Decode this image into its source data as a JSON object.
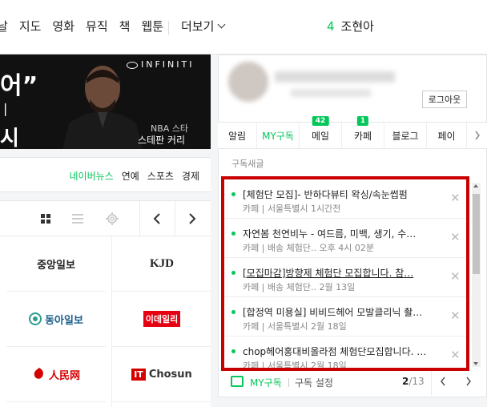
{
  "nav": {
    "items": [
      "날",
      "지도",
      "영화",
      "뮤직",
      "책",
      "웹툰"
    ],
    "more_label": "더보기",
    "weather": {
      "temp": "4",
      "location": "조현아"
    }
  },
  "banner": {
    "quote": "어”",
    "line1": "|",
    "line2": "시",
    "brand": "INFINITI",
    "caption1": "NBA 스타",
    "caption2": "스테판 커리"
  },
  "news_tabs": [
    "네이버뉴스",
    "연예",
    "스포츠",
    "경제"
  ],
  "press": [
    "중앙일보",
    "KJD",
    "동아일보",
    "이데일리",
    "人民网",
    "Chosun"
  ],
  "account": {
    "logout_label": "로그아웃"
  },
  "tabs": [
    {
      "label": "알림",
      "badge": ""
    },
    {
      "label": "MY구독",
      "badge": "",
      "active": true
    },
    {
      "label": "메일",
      "badge": "42"
    },
    {
      "label": "카페",
      "badge": "1"
    },
    {
      "label": "블로그",
      "badge": ""
    },
    {
      "label": "페이",
      "badge": ""
    }
  ],
  "panel": {
    "section_title": "구독새글",
    "items": [
      {
        "title": "[체험단 모집]- 반하다뷰티 왁싱/속눈썹펌",
        "meta": "카페 | 서울특별시 1시간전"
      },
      {
        "title": "자연봄 천연비누 - 여드름, 미백, 생기, 수…",
        "meta": "카페 | 배송 체험단.. 오후 4시 02분"
      },
      {
        "title": "[모집마감]방향제 체험단 모집합니다. 참…",
        "meta": "카페 | 배송 체험단.. 2월 13일"
      },
      {
        "title": "[합정역 미용실] 비비드헤어 모발클리닉 촬…",
        "meta": "카페 | 서울특별시 2월 18일"
      },
      {
        "title": "chop헤어홍대비올라점 체험단모집합니다. …",
        "meta": "카페 | 서울특별시 2월 18일"
      }
    ],
    "footer": {
      "my_label": "MY구독",
      "setting_label": "구독 설정",
      "page_current": "2",
      "page_total": "/13"
    }
  }
}
